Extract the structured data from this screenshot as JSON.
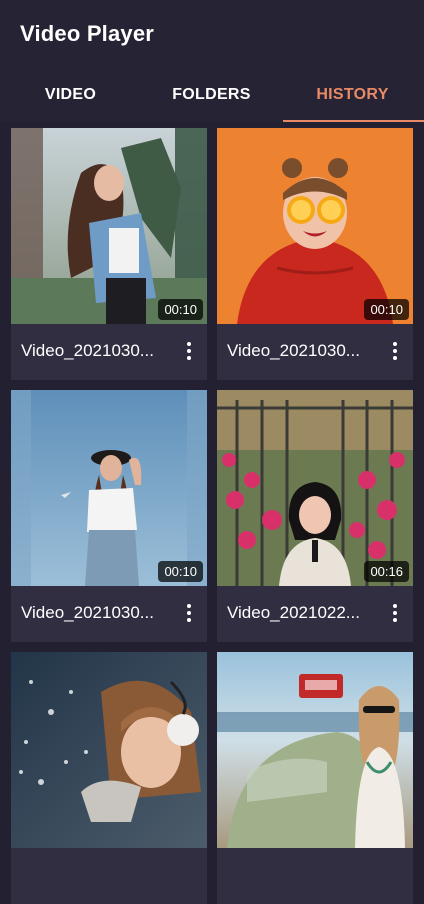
{
  "app": {
    "title": "Video Player"
  },
  "tabs": [
    {
      "label": "VIDEO",
      "active": false
    },
    {
      "label": "FOLDERS",
      "active": false
    },
    {
      "label": "HISTORY",
      "active": true
    }
  ],
  "videos": [
    {
      "title": "Video_2021030...",
      "duration": "00:10"
    },
    {
      "title": "Video_2021030...",
      "duration": "00:10"
    },
    {
      "title": "Video_2021030...",
      "duration": "00:10"
    },
    {
      "title": "Video_2021022...",
      "duration": "00:16"
    },
    {
      "title": "",
      "duration": ""
    },
    {
      "title": "",
      "duration": ""
    }
  ],
  "colors": {
    "background": "#222031",
    "card": "#302e40",
    "accent": "#e88a66"
  },
  "icons": {
    "more": "more-vertical-icon"
  }
}
